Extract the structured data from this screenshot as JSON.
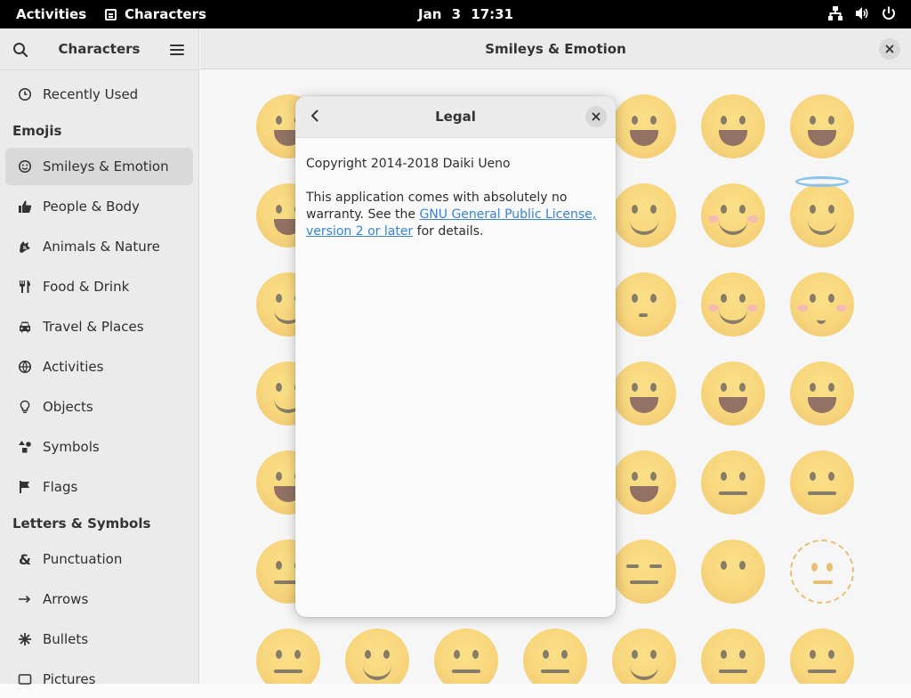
{
  "topbar": {
    "activities": "Activities",
    "app_name": "Characters",
    "date": "Jan 3",
    "time": "17:31"
  },
  "sidebar": {
    "title": "Characters",
    "recently_used": "Recently Used",
    "section_emojis": "Emojis",
    "items": [
      {
        "label": "Smileys & Emotion",
        "icon": "smiley-icon",
        "selected": true
      },
      {
        "label": "People & Body",
        "icon": "thumbs-up-icon"
      },
      {
        "label": "Animals & Nature",
        "icon": "paw-icon"
      },
      {
        "label": "Food & Drink",
        "icon": "cutlery-icon"
      },
      {
        "label": "Travel & Places",
        "icon": "car-icon"
      },
      {
        "label": "Activities",
        "icon": "ball-icon"
      },
      {
        "label": "Objects",
        "icon": "bulb-icon"
      },
      {
        "label": "Symbols",
        "icon": "shapes-icon"
      },
      {
        "label": "Flags",
        "icon": "flag-icon"
      }
    ],
    "section_letters": "Letters & Symbols",
    "letters": [
      {
        "label": "Punctuation",
        "icon": "ampersand-icon"
      },
      {
        "label": "Arrows",
        "icon": "arrow-icon"
      },
      {
        "label": "Bullets",
        "icon": "bullet-icon"
      },
      {
        "label": "Pictures",
        "icon": "picture-icon"
      }
    ]
  },
  "main": {
    "title": "Smileys & Emotion"
  },
  "dialog": {
    "title": "Legal",
    "copyright": "Copyright 2014-2018 Daiki Ueno",
    "warranty": "This application comes with absolutely no warranty.",
    "see_the": "See the",
    "license_link": "GNU General Public License, version 2 or later",
    "for_details": "for details."
  }
}
